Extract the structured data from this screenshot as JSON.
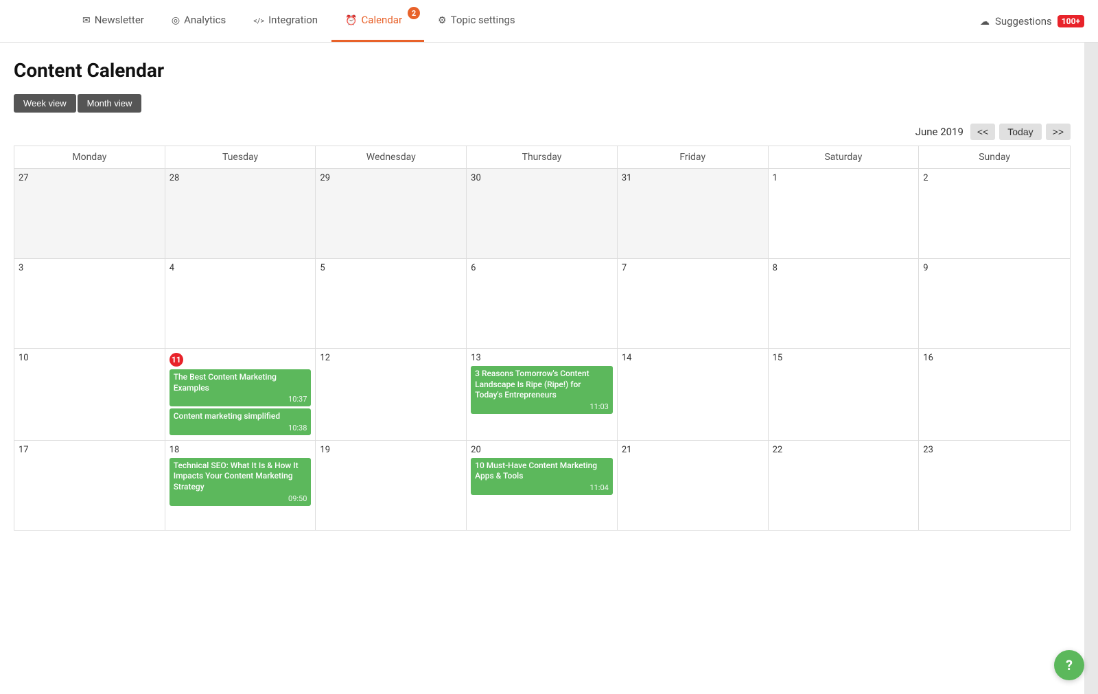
{
  "nav": {
    "tabs": [
      {
        "id": "newsletter",
        "label": "Newsletter",
        "icon": "newsletter",
        "active": false,
        "badge": null
      },
      {
        "id": "analytics",
        "label": "Analytics",
        "icon": "analytics",
        "active": false,
        "badge": null
      },
      {
        "id": "integration",
        "label": "Integration",
        "icon": "integration",
        "active": false,
        "badge": null
      },
      {
        "id": "calendar",
        "label": "Calendar",
        "icon": "calendar",
        "active": true,
        "badge": "2"
      },
      {
        "id": "topic-settings",
        "label": "Topic settings",
        "icon": "topic",
        "active": false,
        "badge": null
      }
    ],
    "suggestions_label": "Suggestions",
    "suggestions_badge": "100+"
  },
  "page": {
    "title": "Content Calendar"
  },
  "view_toggle": {
    "week_view": "Week view",
    "month_view": "Month view"
  },
  "calendar": {
    "month_label": "June 2019",
    "nav_prev": "<<",
    "nav_today": "Today",
    "nav_next": ">>",
    "day_headers": [
      "Monday",
      "Tuesday",
      "Wednesday",
      "Thursday",
      "Friday",
      "Saturday",
      "Sunday"
    ],
    "weeks": [
      {
        "days": [
          {
            "date": "27",
            "type": "prev",
            "events": []
          },
          {
            "date": "28",
            "type": "prev",
            "events": []
          },
          {
            "date": "29",
            "type": "prev",
            "events": []
          },
          {
            "date": "30",
            "type": "prev",
            "events": []
          },
          {
            "date": "31",
            "type": "prev",
            "events": []
          },
          {
            "date": "1",
            "type": "current",
            "events": []
          },
          {
            "date": "2",
            "type": "current",
            "events": []
          }
        ]
      },
      {
        "days": [
          {
            "date": "3",
            "type": "current",
            "events": []
          },
          {
            "date": "4",
            "type": "current",
            "events": []
          },
          {
            "date": "5",
            "type": "current",
            "events": []
          },
          {
            "date": "6",
            "type": "current",
            "events": []
          },
          {
            "date": "7",
            "type": "current",
            "events": []
          },
          {
            "date": "8",
            "type": "current",
            "events": []
          },
          {
            "date": "9",
            "type": "current",
            "events": []
          }
        ]
      },
      {
        "days": [
          {
            "date": "10",
            "type": "current",
            "events": []
          },
          {
            "date": "11",
            "type": "current",
            "badge": true,
            "events": [
              {
                "title": "The Best Content Marketing Examples",
                "time": "10:37"
              },
              {
                "title": "Content marketing simplified",
                "time": "10:38"
              }
            ]
          },
          {
            "date": "12",
            "type": "current",
            "events": []
          },
          {
            "date": "13",
            "type": "current",
            "events": [
              {
                "title": "3 Reasons Tomorrow's Content Landscape Is Ripe (Ripe!) for Today's Entrepreneurs",
                "time": "11:03"
              }
            ]
          },
          {
            "date": "14",
            "type": "current",
            "events": []
          },
          {
            "date": "15",
            "type": "current",
            "events": []
          },
          {
            "date": "16",
            "type": "current",
            "events": []
          }
        ]
      },
      {
        "days": [
          {
            "date": "17",
            "type": "current",
            "events": []
          },
          {
            "date": "18",
            "type": "current",
            "events": [
              {
                "title": "Technical SEO: What It Is & How It Impacts Your Content Marketing Strategy",
                "time": "09:50"
              }
            ]
          },
          {
            "date": "19",
            "type": "current",
            "events": []
          },
          {
            "date": "20",
            "type": "current",
            "events": [
              {
                "title": "10 Must-Have Content Marketing Apps & Tools",
                "time": "11:04"
              }
            ]
          },
          {
            "date": "21",
            "type": "current",
            "events": []
          },
          {
            "date": "22",
            "type": "current",
            "events": []
          },
          {
            "date": "23",
            "type": "current",
            "events": []
          }
        ]
      }
    ]
  }
}
